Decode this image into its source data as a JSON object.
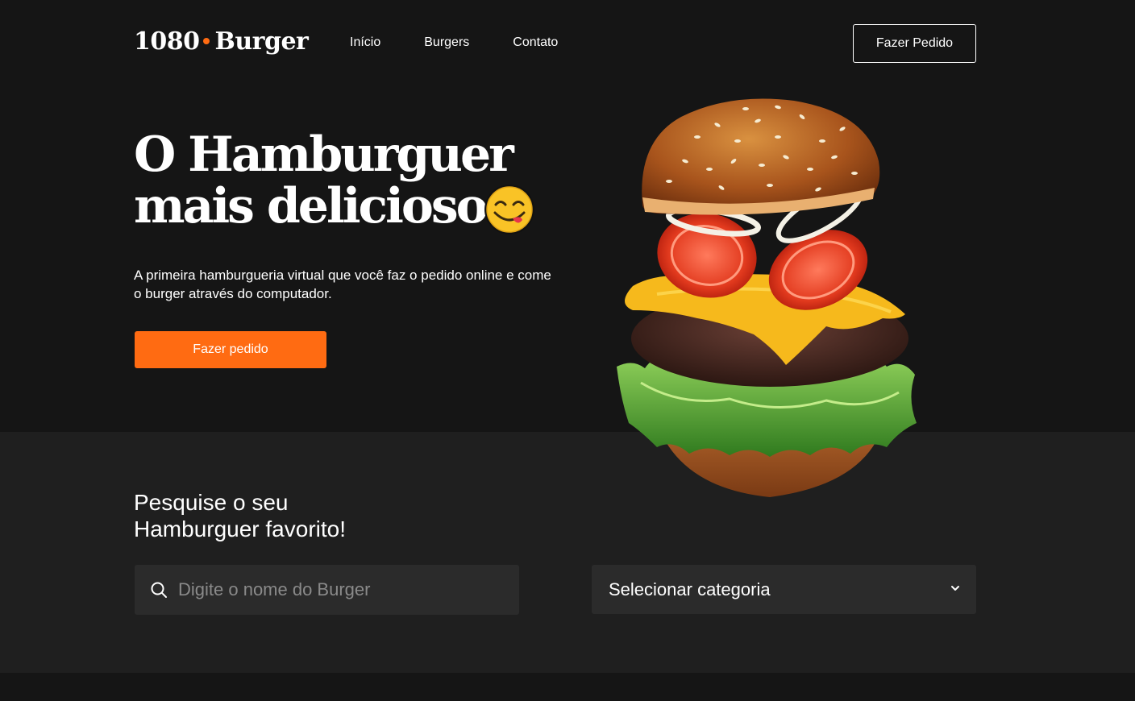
{
  "header": {
    "logo_number": "1080",
    "logo_word": "Burger",
    "nav": [
      {
        "label": "Início"
      },
      {
        "label": "Burgers"
      },
      {
        "label": "Contato"
      }
    ],
    "cta_label": "Fazer Pedido"
  },
  "hero": {
    "title_line1": "O Hamburguer",
    "title_line2": "mais delicioso.",
    "emoji_icon": "face-savoring-food-icon",
    "subtitle": "A primeira hamburgueria virtual que você faz o pedido online e come o burger através do computador.",
    "cta_label": "Fazer pedido",
    "image_icon": "burger-image"
  },
  "search": {
    "title_line1": "Pesquise o seu",
    "title_line2": "Hamburguer favorito!",
    "placeholder": "Digite o nome do Burger",
    "search_icon": "search-icon",
    "category_label": "Selecionar categoria",
    "chevron_icon": "chevron-down-icon"
  },
  "colors": {
    "accent": "#ff6b12",
    "background": "#151515",
    "section_bg": "#1f1f1f",
    "input_bg": "#2b2b2b"
  }
}
